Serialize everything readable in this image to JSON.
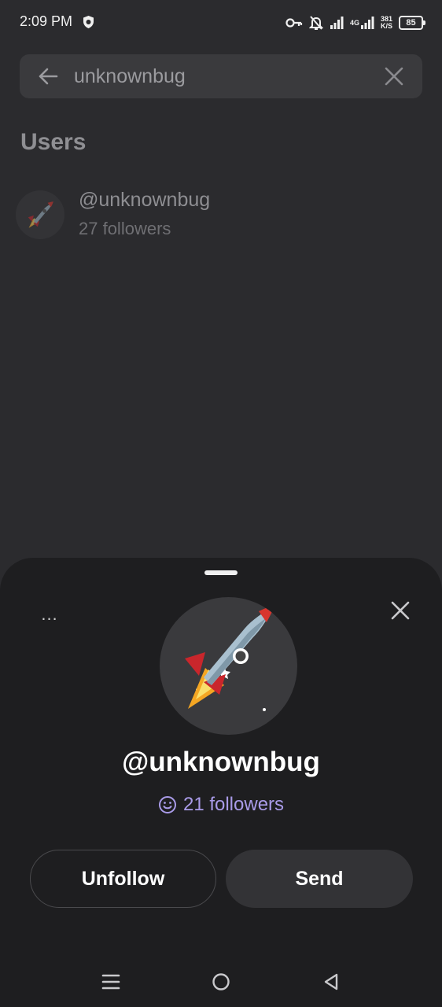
{
  "status_bar": {
    "time": "2:09 PM",
    "signal_4g": "4G",
    "net_speed_value": "381",
    "net_speed_unit": "K/S",
    "battery": "85",
    "icons": [
      "shield-icon",
      "key-icon",
      "bell-off-icon",
      "signal-icon",
      "signal-4g-icon"
    ]
  },
  "search": {
    "query": "unknownbug",
    "back_icon": "arrow-left-icon",
    "clear_icon": "close-icon"
  },
  "results": {
    "section_title": "Users",
    "users": [
      {
        "username": "@unknownbug",
        "followers": "27 followers",
        "avatar": "rocket-emoji"
      }
    ]
  },
  "profile_sheet": {
    "more_label": "...",
    "username": "@unknownbug",
    "followers": "21 followers",
    "followers_icon": "smiley-icon",
    "unfollow_label": "Unfollow",
    "send_label": "Send",
    "avatar": "rocket-emoji"
  },
  "nav_bar": {
    "icons": [
      "menu-icon",
      "home-icon",
      "back-icon"
    ]
  },
  "colors": {
    "background": "#2b2b2e",
    "sheet": "#1e1e20",
    "followers_accent": "#a99be8"
  }
}
